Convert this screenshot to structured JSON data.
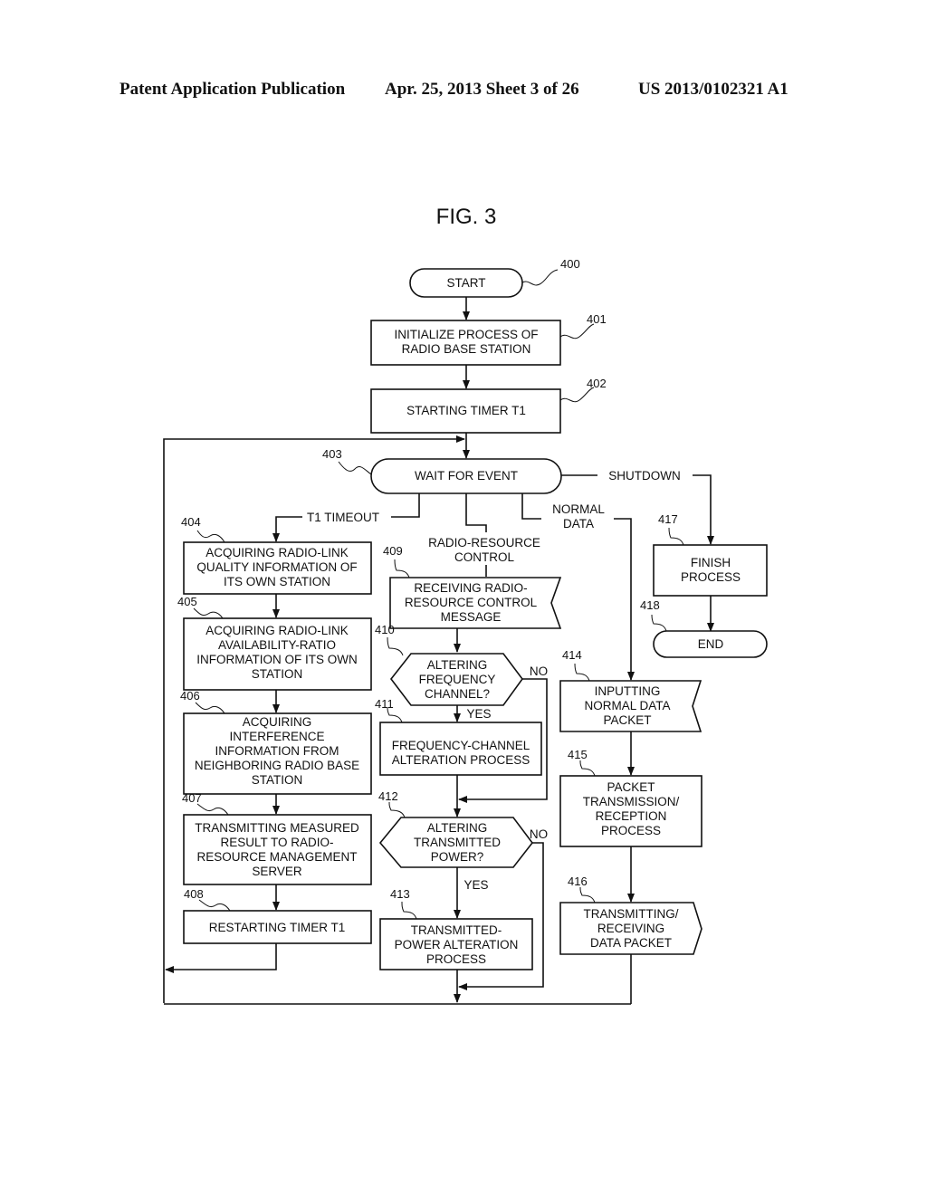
{
  "header": {
    "publication_type": "Patent Application Publication",
    "date_sheet": "Apr. 25, 2013  Sheet 3 of 26",
    "pub_number": "US 2013/0102321 A1"
  },
  "figure": {
    "title": "FIG. 3",
    "nodes": {
      "n400": {
        "ref": "400",
        "type": "terminal",
        "lines": [
          "START"
        ]
      },
      "n401": {
        "ref": "401",
        "type": "process",
        "lines": [
          "INITIALIZE PROCESS OF",
          "RADIO BASE STATION"
        ]
      },
      "n402": {
        "ref": "402",
        "type": "process",
        "lines": [
          "STARTING TIMER T1"
        ]
      },
      "n403": {
        "ref": "403",
        "type": "terminal",
        "lines": [
          "WAIT FOR EVENT"
        ]
      },
      "n404": {
        "ref": "404",
        "type": "process",
        "lines": [
          "ACQUIRING RADIO-LINK",
          "QUALITY INFORMATION OF",
          "ITS OWN STATION"
        ]
      },
      "n405": {
        "ref": "405",
        "type": "process",
        "lines": [
          "ACQUIRING RADIO-LINK",
          "AVAILABILITY-RATIO",
          "INFORMATION OF ITS OWN",
          "STATION"
        ]
      },
      "n406": {
        "ref": "406",
        "type": "process",
        "lines": [
          "ACQUIRING",
          "INTERFERENCE",
          "INFORMATION FROM",
          "NEIGHBORING RADIO BASE",
          "STATION"
        ]
      },
      "n407": {
        "ref": "407",
        "type": "process",
        "lines": [
          "TRANSMITTING MEASURED",
          "RESULT TO RADIO-",
          "RESOURCE MANAGEMENT",
          "SERVER"
        ]
      },
      "n408": {
        "ref": "408",
        "type": "process",
        "lines": [
          "RESTARTING TIMER T1"
        ]
      },
      "n409": {
        "ref": "409",
        "type": "receive",
        "lines": [
          "RECEIVING RADIO-",
          "RESOURCE CONTROL",
          "MESSAGE"
        ]
      },
      "n410": {
        "ref": "410",
        "type": "decision",
        "lines": [
          "ALTERING",
          "FREQUENCY",
          "CHANNEL?"
        ]
      },
      "n411": {
        "ref": "411",
        "type": "process",
        "lines": [
          "FREQUENCY-CHANNEL",
          "ALTERATION PROCESS"
        ]
      },
      "n412": {
        "ref": "412",
        "type": "decision",
        "lines": [
          "ALTERING",
          "TRANSMITTED",
          "POWER?"
        ]
      },
      "n413": {
        "ref": "413",
        "type": "process",
        "lines": [
          "TRANSMITTED-",
          "POWER ALTERATION",
          "PROCESS"
        ]
      },
      "n414": {
        "ref": "414",
        "type": "receive",
        "lines": [
          "INPUTTING",
          "NORMAL DATA",
          "PACKET"
        ]
      },
      "n415": {
        "ref": "415",
        "type": "process",
        "lines": [
          "PACKET",
          "TRANSMISSION/",
          "RECEPTION",
          "PROCESS"
        ]
      },
      "n416": {
        "ref": "416",
        "type": "send",
        "lines": [
          "TRANSMITTING/",
          "RECEIVING",
          "DATA PACKET"
        ]
      },
      "n417": {
        "ref": "417",
        "type": "process",
        "lines": [
          "FINISH",
          "PROCESS"
        ]
      },
      "n418": {
        "ref": "418",
        "type": "terminal",
        "lines": [
          "END"
        ]
      }
    },
    "edge_labels": {
      "shutdown": [
        "SHUTDOWN"
      ],
      "t1_timeout": [
        "T1 TIMEOUT"
      ],
      "radio_resource_control": [
        "RADIO-RESOURCE",
        "CONTROL"
      ],
      "normal_data": [
        "NORMAL",
        "DATA"
      ],
      "no_410": [
        "NO"
      ],
      "yes_410": [
        "YES"
      ],
      "no_412": [
        "NO"
      ],
      "yes_412": [
        "YES"
      ]
    }
  }
}
